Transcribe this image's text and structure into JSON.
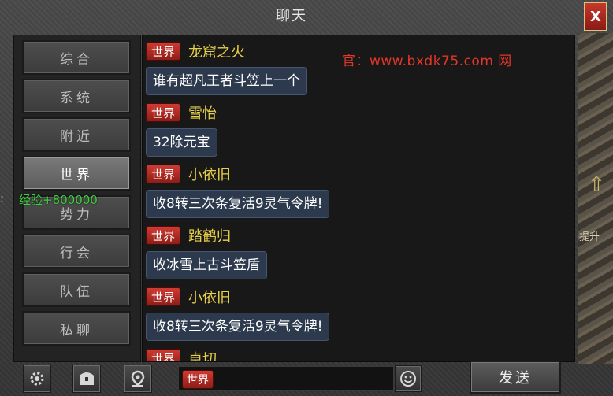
{
  "window": {
    "title": "聊天",
    "close_label": "X"
  },
  "nav": {
    "items": [
      {
        "label": "综合"
      },
      {
        "label": "系统"
      },
      {
        "label": "附近"
      },
      {
        "label": "世界",
        "active": true
      },
      {
        "label": "势力"
      },
      {
        "label": "行会"
      },
      {
        "label": "队伍"
      },
      {
        "label": "私聊"
      }
    ]
  },
  "overlay": {
    "exp_text": "经验+800000",
    "left_fragment": ":",
    "right_fragment": "提升"
  },
  "watermark": "官：www.bxdk75.com 网",
  "messages": [
    {
      "channel": "世界",
      "sender": "龙窟之火",
      "text": "谁有超凡王者斗笠上一个"
    },
    {
      "channel": "世界",
      "sender": "雪怡",
      "text": "32除元宝"
    },
    {
      "channel": "世界",
      "sender": "小依旧",
      "text": "收8转三次条复活9灵气令牌!"
    },
    {
      "channel": "世界",
      "sender": "踏鹤归",
      "text": "收冰雪上古斗笠盾"
    },
    {
      "channel": "世界",
      "sender": "小依旧",
      "text": "收8转三次条复活9灵气令牌!"
    },
    {
      "channel": "世界",
      "sender": "卓切",
      "text": ""
    }
  ],
  "bottom_bar": {
    "icons": [
      "gear-icon",
      "chest-icon",
      "location-pin-icon"
    ],
    "input_channel": "世界",
    "input_value": "",
    "emoji_icon": "smiley-icon",
    "send_label": "发送"
  },
  "colors": {
    "channel_red": "#cf3b32",
    "sender_yellow": "#e9d04a",
    "exp_green": "#3fd13f",
    "watermark_red": "#e3362a",
    "bubble_blue": "#2d3a4e"
  }
}
